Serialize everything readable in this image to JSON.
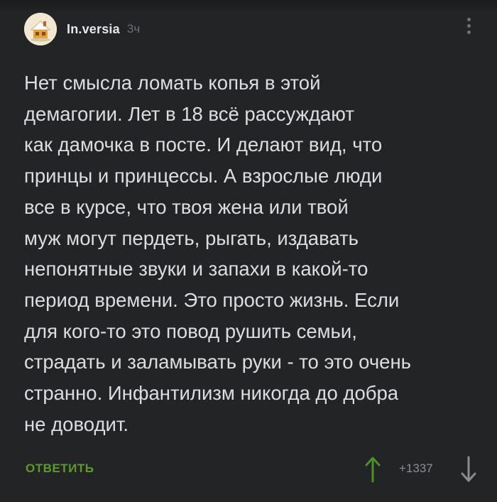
{
  "comment": {
    "author": {
      "username": "In.versia",
      "avatar_icon": "house-avatar-icon"
    },
    "time": "3ч",
    "text": "Нет смысла ломать копья в этой\nдемагогии. Лет в 18 всё рассуждают\nкак дамочка в посте. И делают вид, что\nпринцы и принцессы. А взрослые люди\nвсе в курсе, что твоя жена или твой\nмуж могут пердеть, рыгать, издавать\nнепонятные звуки и запахи в какой-то\nпериод времени. Это просто жизнь. Если\nдля кого-то это повод рушить семьи,\nстрадать и заламывать руки - то это очень\nстранно. Инфантилизм никогда до добра\nне доводит.",
    "actions": {
      "reply_label": "ОТВЕТИТЬ",
      "rating": "+1337",
      "more_icon": "more-vertical-icon",
      "upvote_icon": "arrow-up-icon",
      "downvote_icon": "arrow-down-icon"
    }
  },
  "colors": {
    "background": "#222426",
    "text": "#dcdde0",
    "muted": "#6b6e73",
    "accent_green": "#5c9a2c",
    "upvote_green": "#4d8f2a"
  }
}
